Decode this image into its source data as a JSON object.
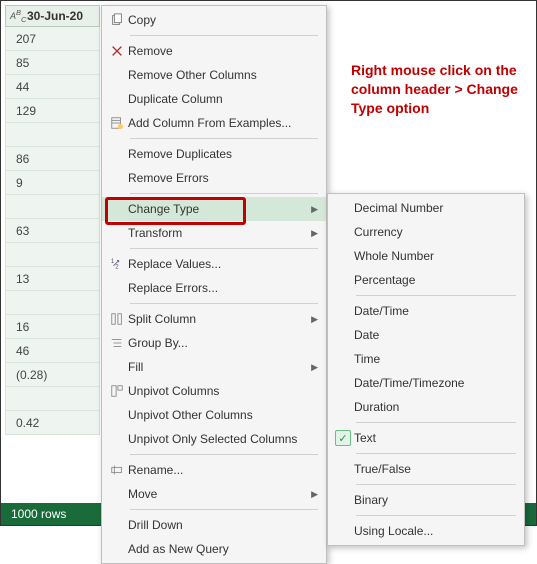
{
  "column": {
    "header_label": "30-Jun-20",
    "icon_name": "abc-type-icon",
    "rows": [
      "207",
      "85",
      "44",
      "129",
      "",
      "86",
      "9",
      "",
      "63",
      "",
      "13",
      "",
      "16",
      "46",
      "(0.28)",
      "",
      "0.42"
    ]
  },
  "status": {
    "rows_label": "1000 rows"
  },
  "annotation": {
    "text": "Right mouse click on the column header > Change Type option"
  },
  "menu": {
    "copy": "Copy",
    "remove": "Remove",
    "remove_other": "Remove Other Columns",
    "duplicate": "Duplicate Column",
    "add_from_examples": "Add Column From Examples...",
    "remove_dup": "Remove Duplicates",
    "remove_err": "Remove Errors",
    "change_type": "Change Type",
    "transform": "Transform",
    "replace_values": "Replace Values...",
    "replace_errors": "Replace Errors...",
    "split_column": "Split Column",
    "group_by": "Group By...",
    "fill": "Fill",
    "unpivot": "Unpivot Columns",
    "unpivot_other": "Unpivot Other Columns",
    "unpivot_selected": "Unpivot Only Selected Columns",
    "rename": "Rename...",
    "move": "Move",
    "drill_down": "Drill Down",
    "add_new_query": "Add as New Query"
  },
  "submenu": {
    "decimal": "Decimal Number",
    "currency": "Currency",
    "whole": "Whole Number",
    "percentage": "Percentage",
    "datetime": "Date/Time",
    "date": "Date",
    "time": "Time",
    "datetimezone": "Date/Time/Timezone",
    "duration": "Duration",
    "text": "Text",
    "truefalse": "True/False",
    "binary": "Binary",
    "using_locale": "Using Locale..."
  }
}
